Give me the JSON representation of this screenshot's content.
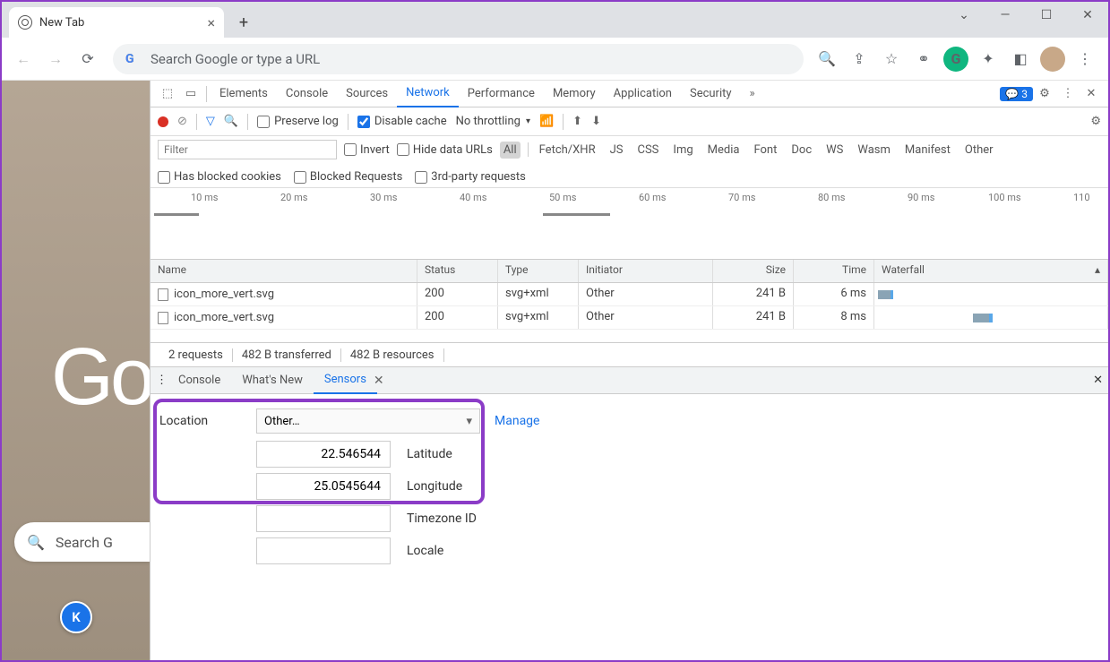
{
  "window": {
    "tab_title": "New Tab"
  },
  "omnibox": {
    "placeholder": "Search Google or type a URL"
  },
  "content": {
    "logo_fragment": "Go",
    "search_fragment": "Search G",
    "badge_letter": "K"
  },
  "devtools": {
    "panels": [
      "Elements",
      "Console",
      "Sources",
      "Network",
      "Performance",
      "Memory",
      "Application",
      "Security"
    ],
    "active_panel": "Network",
    "issues_count": "3",
    "net": {
      "preserve_log": "Preserve log",
      "disable_cache": "Disable cache",
      "throttling": "No throttling",
      "filter_placeholder": "Filter",
      "invert": "Invert",
      "hide_urls": "Hide data URLs",
      "types": [
        "All",
        "Fetch/XHR",
        "JS",
        "CSS",
        "Img",
        "Media",
        "Font",
        "Doc",
        "WS",
        "Wasm",
        "Manifest",
        "Other"
      ],
      "blocked_cookies": "Has blocked cookies",
      "blocked_req": "Blocked Requests",
      "third_party": "3rd-party requests",
      "ticks": [
        "10 ms",
        "20 ms",
        "30 ms",
        "40 ms",
        "50 ms",
        "60 ms",
        "70 ms",
        "80 ms",
        "90 ms",
        "100 ms",
        "110"
      ],
      "cols": {
        "name": "Name",
        "status": "Status",
        "type": "Type",
        "initiator": "Initiator",
        "size": "Size",
        "time": "Time",
        "waterfall": "Waterfall"
      },
      "rows": [
        {
          "name": "icon_more_vert.svg",
          "status": "200",
          "type": "svg+xml",
          "initiator": "Other",
          "size": "241 B",
          "time": "6 ms"
        },
        {
          "name": "icon_more_vert.svg",
          "status": "200",
          "type": "svg+xml",
          "initiator": "Other",
          "size": "241 B",
          "time": "8 ms"
        }
      ],
      "summary": {
        "requests": "2 requests",
        "transferred": "482 B transferred",
        "resources": "482 B resources"
      }
    },
    "drawer": {
      "tabs": [
        "Console",
        "What's New",
        "Sensors"
      ],
      "active": "Sensors",
      "sensors": {
        "location_label": "Location",
        "location_select": "Other…",
        "manage": "Manage",
        "latitude": "22.546544",
        "latitude_label": "Latitude",
        "longitude": "25.0545644",
        "longitude_label": "Longitude",
        "timezone_label": "Timezone ID",
        "locale_label": "Locale"
      }
    }
  }
}
